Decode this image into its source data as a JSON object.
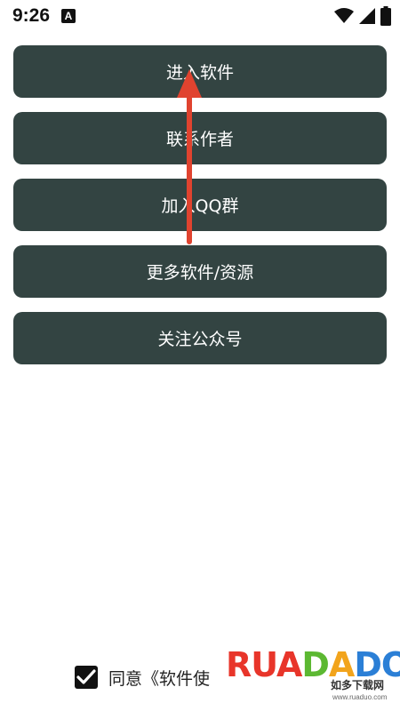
{
  "status_bar": {
    "time": "9:26",
    "notification_icon": "A",
    "wifi_icon": "wifi-icon",
    "signal_icon": "signal-icon",
    "battery_icon": "battery-icon"
  },
  "menu": {
    "enter_software": "进入软件",
    "contact_author": "联系作者",
    "join_qq_group": "加入QQ群",
    "more_software": "更多软件/资源",
    "follow_account": "关注公众号"
  },
  "footer": {
    "agree_text": "同意《软件使",
    "checked": true
  },
  "watermark": {
    "brand": "RUANDADO",
    "cn": "如多下载网",
    "url": "www.ruaduo.com"
  },
  "colors": {
    "button_bg": "#334442",
    "button_text": "#ffffff",
    "annotation_arrow": "#e0432f"
  }
}
